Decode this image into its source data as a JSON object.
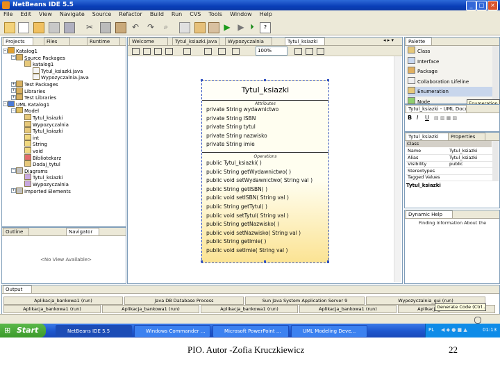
{
  "window": {
    "title": "NetBeans IDE 5.5"
  },
  "menu": [
    "File",
    "Edit",
    "View",
    "Navigate",
    "Source",
    "Refactor",
    "Build",
    "Run",
    "CVS",
    "Tools",
    "Window",
    "Help"
  ],
  "left_top_tabs": [
    "Projects",
    "Files",
    "Runtime"
  ],
  "tree": [
    {
      "label": "Katalog1",
      "indent": 0
    },
    {
      "label": "Source Packages",
      "indent": 1
    },
    {
      "label": "katalog1",
      "indent": 2
    },
    {
      "label": "Tytul_ksiazki.java",
      "indent": 3
    },
    {
      "label": "Wypozyczalnia.java",
      "indent": 3
    },
    {
      "label": "Test Packages",
      "indent": 1
    },
    {
      "label": "Libraries",
      "indent": 1
    },
    {
      "label": "Test Libraries",
      "indent": 1
    },
    {
      "label": "UML Katalog1",
      "indent": 0
    },
    {
      "label": "Model",
      "indent": 1
    },
    {
      "label": "Tytul_ksiazki",
      "indent": 2
    },
    {
      "label": "Wypozyczalnia",
      "indent": 2
    },
    {
      "label": "Tytul_ksiazki",
      "indent": 2
    },
    {
      "label": "int",
      "indent": 2
    },
    {
      "label": "String",
      "indent": 2
    },
    {
      "label": "void",
      "indent": 2
    },
    {
      "label": "Bibliotekarz",
      "indent": 2
    },
    {
      "label": "Dodaj_tytul",
      "indent": 2
    },
    {
      "label": "Diagrams",
      "indent": 1
    },
    {
      "label": "Tytul_ksiazki",
      "indent": 2
    },
    {
      "label": "Wypozyczalnia",
      "indent": 2
    },
    {
      "label": "Imported Elements",
      "indent": 1
    }
  ],
  "left_bottom_tabs": [
    "Outline",
    "Navigator"
  ],
  "navigator_empty": "<No View Available>",
  "editor_tabs": [
    "Welcome",
    "Tytul_ksiazki.java",
    "Wypozyczalnia",
    "Tytul_ksiazki"
  ],
  "zoom": "100%",
  "uml_class": {
    "name": "Tytul_ksiazki",
    "attributes_title": "Attributes",
    "attributes": [
      "private String wydawnictwo",
      "private String ISBN",
      "private String tytul",
      "private String nazwisko",
      "private String imie"
    ],
    "operations_title": "Operations",
    "operations": [
      "public  Tytul_ksiazki( )",
      "public  String  getWydawnictwo( )",
      "public  void  setWydawnictwo( String val )",
      "public  String  getISBN( )",
      "public  void  setISBN( String val )",
      "public  String  getTytul( )",
      "public  void  setTytul( String val )",
      "public  String  getNazwisko( )",
      "public  void  setNazwisko( String val )",
      "public  String  getImie( )",
      "public  void  setImie( String val )"
    ]
  },
  "palette": {
    "title": "Palette",
    "items": [
      "Class",
      "Interface",
      "Package",
      "Collaboration Lifeline",
      "Enumeration",
      "Node"
    ],
    "tooltip": "Enumeration"
  },
  "docs_title": "Tytul_ksiazki - UML Docu...",
  "doc_format_buttons": [
    "B",
    "I",
    "U"
  ],
  "properties": {
    "tabs": [
      "Tytul_ksiazki",
      "Properties"
    ],
    "section": "Class",
    "rows": [
      {
        "key": "Name",
        "value": "Tytul_ksiazki"
      },
      {
        "key": "Alias",
        "value": "Tytul_ksiazki"
      },
      {
        "key": "Visibility",
        "value": "public"
      },
      {
        "key": "Stereotypes",
        "value": ""
      },
      {
        "key": "Tagged Values",
        "value": ""
      }
    ],
    "footer": "Tytul_ksiazki"
  },
  "dynamic_help": {
    "title": "Dynamic Help",
    "items": [
      "Finding Information About the"
    ]
  },
  "output": {
    "title": "Output",
    "tabs_row1": [
      "Aplikacja_bankowa1 (run)",
      "Java DB Database Process",
      "Sun Java System Application Server 9",
      "Wypozyczalnia_gui (run)"
    ],
    "tabs_row2": [
      "Aplikacja_bankowa1 (run)",
      "Aplikacja_bankowa1 (run)",
      "Aplikacja_bankowa1 (run)",
      "Aplikacja_bankowa1 (run)",
      "Aplikacja_bankowa1 (run)"
    ],
    "tooltip": "Generate Code (Ctrl..."
  },
  "taskbar": {
    "start": "Start",
    "items": [
      "NetBeans IDE 5.5",
      "Windows Commander ...",
      "Microsoft PowerPoint ...",
      "UML Modeling Deve..."
    ],
    "lang": "PL",
    "time": "01:13"
  },
  "slide_footer": {
    "left": "PIO.  Autor -Zofia Kruczkiewicz",
    "page": "22"
  },
  "colors": {
    "titlebar": "#0a3fb8",
    "chrome": "#ece9d8",
    "class_fill": "#fbe393",
    "selection": "#3050c0",
    "taskbar": "#1f59d0",
    "start": "#3a9a2a"
  }
}
